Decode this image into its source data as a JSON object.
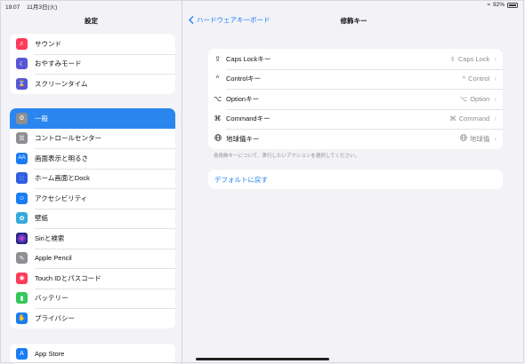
{
  "status": {
    "time": "19:07",
    "date": "11月3日(火)",
    "battery": "92%"
  },
  "sidebar": {
    "title": "設定",
    "group1": [
      {
        "label": "サウンド",
        "icon": "speaker-icon",
        "color": "#ff3b58"
      },
      {
        "label": "おやすみモード",
        "icon": "moon-icon",
        "color": "#5856d6"
      },
      {
        "label": "スクリーンタイム",
        "icon": "hourglass-icon",
        "color": "#5856d6"
      }
    ],
    "group2": [
      {
        "label": "一般",
        "icon": "gear-icon",
        "color": "#8e8e93",
        "selected": true
      },
      {
        "label": "コントロールセンター",
        "icon": "switches-icon",
        "color": "#8e8e93"
      },
      {
        "label": "画面表示と明るさ",
        "icon": "text-size-icon",
        "color": "#1a7cf5"
      },
      {
        "label": "ホーム画面とDock",
        "icon": "grid-icon",
        "color": "#2f5fe0"
      },
      {
        "label": "アクセシビリティ",
        "icon": "accessibility-icon",
        "color": "#1a7cf5"
      },
      {
        "label": "壁紙",
        "icon": "flower-icon",
        "color": "#35aadc"
      },
      {
        "label": "Siriと検索",
        "icon": "siri-icon",
        "color": "#222222"
      },
      {
        "label": "Apple Pencil",
        "icon": "pencil-icon",
        "color": "#8e8e93"
      },
      {
        "label": "Touch IDとパスコード",
        "icon": "fingerprint-icon",
        "color": "#ff3b58"
      },
      {
        "label": "バッテリー",
        "icon": "battery-icon",
        "color": "#34c759"
      },
      {
        "label": "プライバシー",
        "icon": "hand-icon",
        "color": "#1a7cf5"
      }
    ],
    "group3": [
      {
        "label": "App Store",
        "icon": "appstore-icon",
        "color": "#1a7cf5"
      }
    ]
  },
  "nav": {
    "back_label": "ハードウェアキーボード",
    "title": "修飾キー"
  },
  "keys": [
    {
      "label": "Caps Lockキー",
      "value": "Caps Lock",
      "glyph": "⇪",
      "icon": "capslock-icon"
    },
    {
      "label": "Controlキー",
      "value": "Control",
      "glyph": "^",
      "icon": "control-icon"
    },
    {
      "label": "Optionキー",
      "value": "Option",
      "glyph": "⌥",
      "icon": "option-icon"
    },
    {
      "label": "Commandキー",
      "value": "Command",
      "glyph": "⌘",
      "icon": "command-icon"
    },
    {
      "label": "地球儀キー",
      "value": "地球儀",
      "glyph": "🌐",
      "icon": "globe-icon"
    }
  ],
  "footnote": "各修飾キーについて、実行したいアクションを選択してください。",
  "reset_label": "デフォルトに戻す"
}
